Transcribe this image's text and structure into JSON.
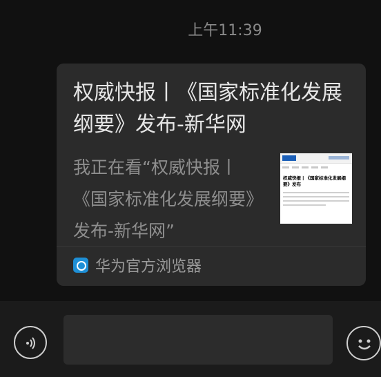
{
  "chat": {
    "timestamp": "上午11:39",
    "message": {
      "title": "权威快报丨《国家标准化发展纲要》发布-新华网",
      "description": "我正在看“权威快报丨《国家标准化发展纲要》发布-新华网”",
      "thumbnail": {
        "headline": "权威快报丨《国家标准化发展纲要》发布"
      },
      "source": {
        "name": "华为官方浏览器",
        "icon": "browser-icon"
      }
    }
  },
  "input": {
    "voice_icon": "voice-icon",
    "emoji_icon": "emoji-icon",
    "placeholder": ""
  },
  "colors": {
    "background": "#111111",
    "card": "#2b2b2b",
    "title_text": "#e6e6e6",
    "secondary_text": "#8e8e8e"
  }
}
